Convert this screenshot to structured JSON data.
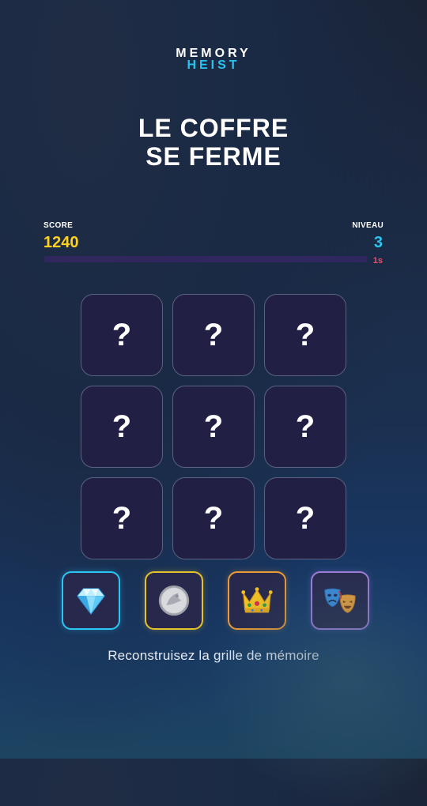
{
  "logo": {
    "line1": "MEMORY",
    "line2": "HEIST"
  },
  "headline": {
    "line1": "LE COFFRE",
    "line2": "SE FERME"
  },
  "hud": {
    "score_label": "SCORE",
    "score_value": "1240",
    "level_label": "NIVEAU",
    "level_value": "3",
    "timer_text": "1s",
    "timer_fraction": 0.0
  },
  "grid": {
    "rows": 3,
    "cols": 3,
    "tiles": [
      "?",
      "?",
      "?",
      "?",
      "?",
      "?",
      "?",
      "?",
      "?"
    ]
  },
  "choices": [
    {
      "icon": "diamond-icon",
      "color": "#2cc6f2"
    },
    {
      "icon": "coin-icon",
      "color": "#e3c22c"
    },
    {
      "icon": "crown-icon",
      "color": "#ec9b34"
    },
    {
      "icon": "theater-masks-icon",
      "color": "#a57fde"
    }
  ],
  "instruction": "Reconstruisez la grille de mémoire",
  "colors": {
    "score": "#ffd21f",
    "level": "#2ec6f0",
    "timer": "#ef4d6c",
    "tile_bg": "#221f44",
    "tile_border": "#5b6180"
  }
}
